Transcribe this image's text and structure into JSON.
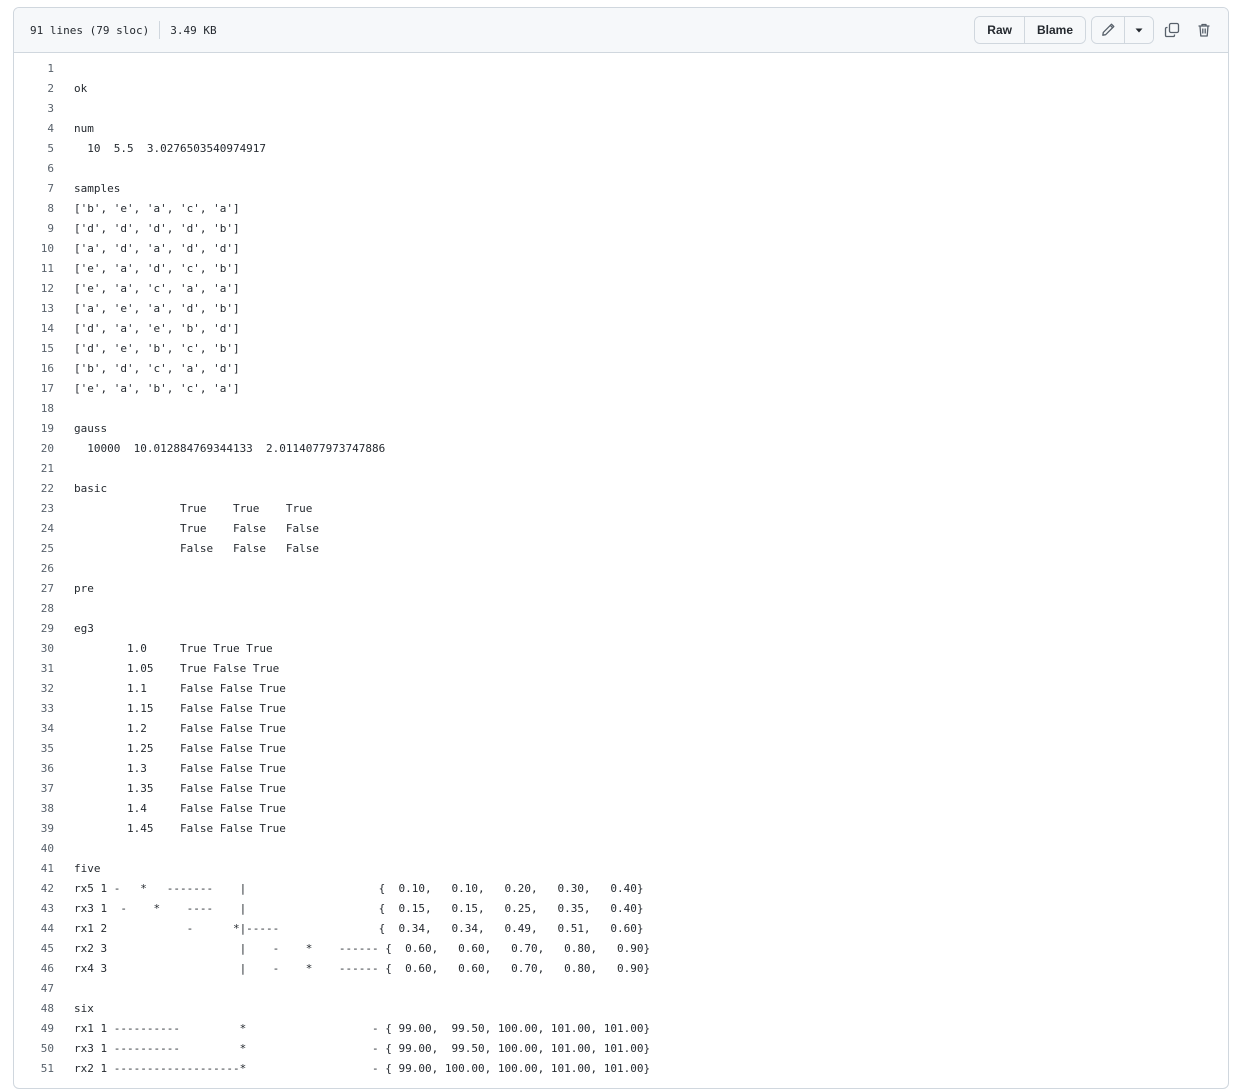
{
  "file_info": {
    "lines": "91 lines (79 sloc)",
    "size": "3.49 KB"
  },
  "actions": {
    "raw": "Raw",
    "blame": "Blame"
  },
  "code_lines": [
    "",
    "ok",
    "",
    "num",
    "  10  5.5  3.0276503540974917",
    "",
    "samples",
    "['b', 'e', 'a', 'c', 'a']",
    "['d', 'd', 'd', 'd', 'b']",
    "['a', 'd', 'a', 'd', 'd']",
    "['e', 'a', 'd', 'c', 'b']",
    "['e', 'a', 'c', 'a', 'a']",
    "['a', 'e', 'a', 'd', 'b']",
    "['d', 'a', 'e', 'b', 'd']",
    "['d', 'e', 'b', 'c', 'b']",
    "['b', 'd', 'c', 'a', 'd']",
    "['e', 'a', 'b', 'c', 'a']",
    "",
    "gauss",
    "  10000  10.012884769344133  2.0114077973747886",
    "",
    "basic",
    "                True    True    True",
    "                True    False   False",
    "                False   False   False",
    "",
    "pre",
    "",
    "eg3",
    "        1.0     True True True",
    "        1.05    True False True",
    "        1.1     False False True",
    "        1.15    False False True",
    "        1.2     False False True",
    "        1.25    False False True",
    "        1.3     False False True",
    "        1.35    False False True",
    "        1.4     False False True",
    "        1.45    False False True",
    "",
    "five",
    "rx5 1 -   *   -------    |                    {  0.10,   0.10,   0.20,   0.30,   0.40}",
    "rx3 1  -    *    ----    |                    {  0.15,   0.15,   0.25,   0.35,   0.40}",
    "rx1 2            -      *|-----               {  0.34,   0.34,   0.49,   0.51,   0.60}",
    "rx2 3                    |    -    *    ------ {  0.60,   0.60,   0.70,   0.80,   0.90}",
    "rx4 3                    |    -    *    ------ {  0.60,   0.60,   0.70,   0.80,   0.90}",
    "",
    "six",
    "rx1 1 ----------         *                   - { 99.00,  99.50, 100.00, 101.00, 101.00}",
    "rx3 1 ----------         *                   - { 99.00,  99.50, 100.00, 101.00, 101.00}",
    "rx2 1 -------------------*                   - { 99.00, 100.00, 100.00, 101.00, 101.00}"
  ]
}
